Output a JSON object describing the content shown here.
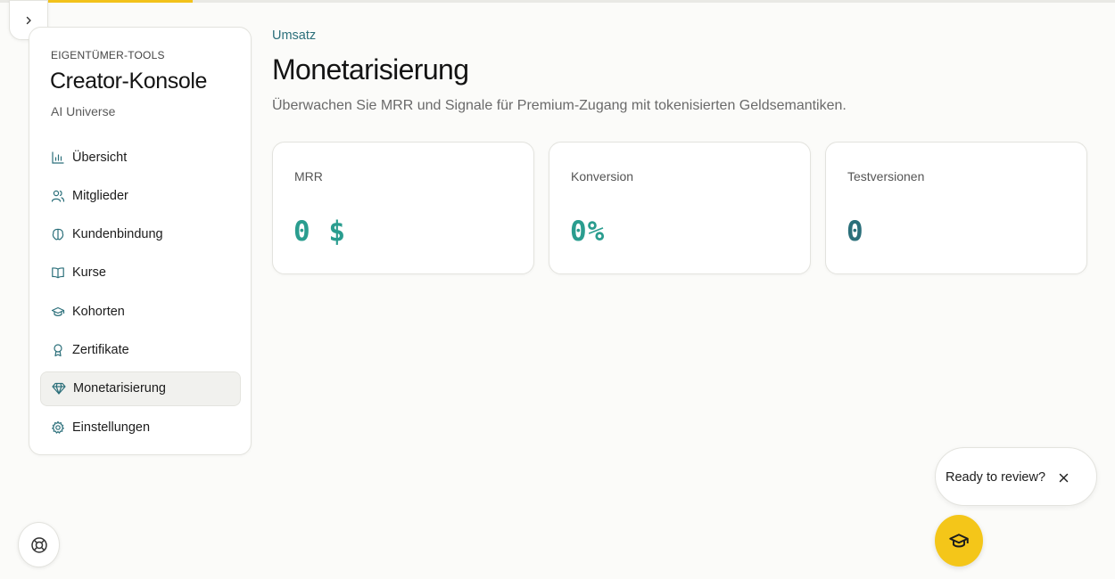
{
  "sidebar": {
    "eyebrow": "EIGENTÜMER-TOOLS",
    "title": "Creator-Konsole",
    "subtitle": "AI Universe",
    "items": [
      {
        "label": "Übersicht",
        "icon": "bar-chart-icon",
        "active": false
      },
      {
        "label": "Mitglieder",
        "icon": "users-icon",
        "active": false
      },
      {
        "label": "Kundenbindung",
        "icon": "brain-icon",
        "active": false
      },
      {
        "label": "Kurse",
        "icon": "book-open-icon",
        "active": false
      },
      {
        "label": "Kohorten",
        "icon": "graduation-cap-icon",
        "active": false
      },
      {
        "label": "Zertifikate",
        "icon": "award-icon",
        "active": false
      },
      {
        "label": "Monetarisierung",
        "icon": "gem-icon",
        "active": true
      },
      {
        "label": "Einstellungen",
        "icon": "gear-icon",
        "active": false
      }
    ]
  },
  "header": {
    "breadcrumb": "Umsatz",
    "title": "Monetarisierung",
    "description": "Überwachen Sie MRR und Signale für Premium-Zugang mit tokenisierten Geldsemantiken."
  },
  "metrics": [
    {
      "label": "MRR",
      "value": "0 $",
      "color": "#2a9d8f"
    },
    {
      "label": "Konversion",
      "value": "0%",
      "color": "#2a9d8f"
    },
    {
      "label": "Testversionen",
      "value": "0",
      "color": "#2b6f7a"
    }
  ],
  "review": {
    "text": "Ready to review?"
  },
  "colors": {
    "accent": "#f4c619",
    "link": "#2b6f7a"
  },
  "progress": {
    "fraction": 0.16
  }
}
